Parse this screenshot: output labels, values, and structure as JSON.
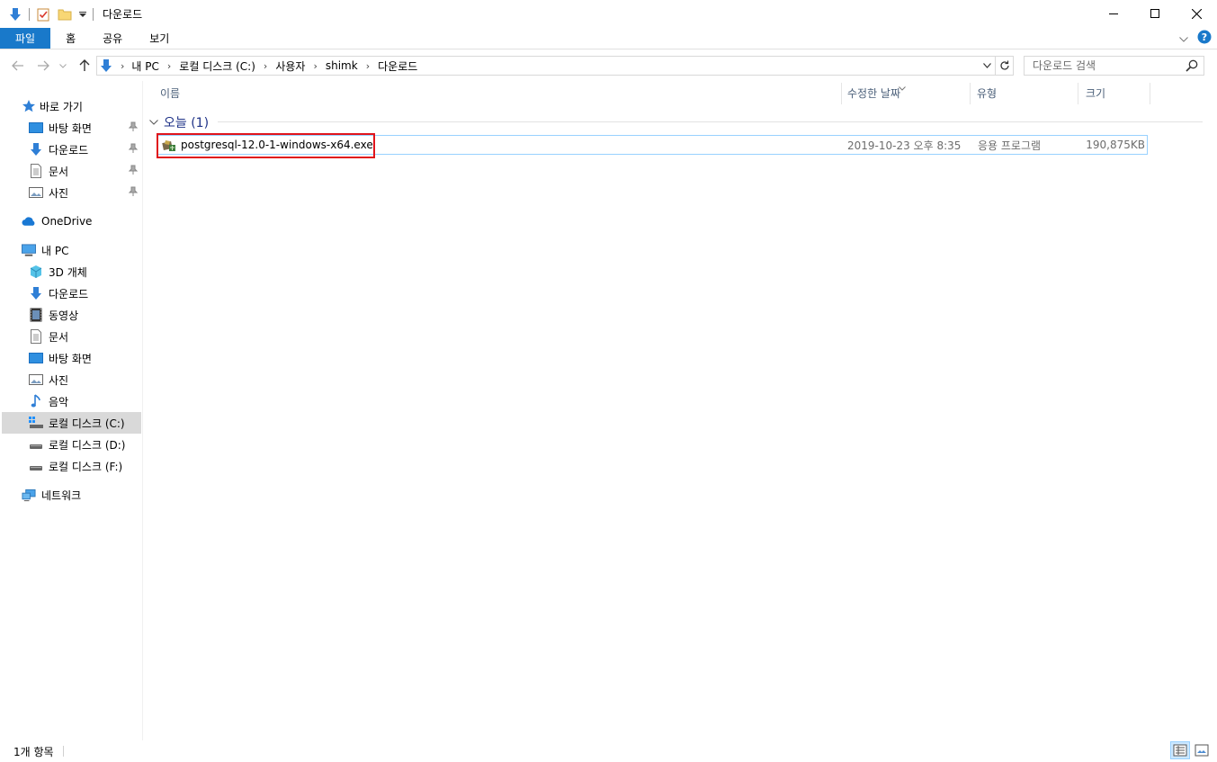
{
  "window": {
    "title": "다운로드"
  },
  "ribbon": {
    "tabs": [
      "파일",
      "홈",
      "공유",
      "보기"
    ]
  },
  "address": {
    "crumbs": [
      "내 PC",
      "로컬 디스크 (C:)",
      "사용자",
      "shimk",
      "다운로드"
    ]
  },
  "search": {
    "placeholder": "다운로드 검색"
  },
  "sidebar": {
    "quick_access": "바로 가기",
    "quick_items": [
      "바탕 화면",
      "다운로드",
      "문서",
      "사진"
    ],
    "onedrive": "OneDrive",
    "this_pc": "내 PC",
    "pc_items": [
      "3D 개체",
      "다운로드",
      "동영상",
      "문서",
      "바탕 화면",
      "사진",
      "음악",
      "로컬 디스크 (C:)",
      "로컬 디스크 (D:)",
      "로컬 디스크 (F:)"
    ],
    "network": "네트워크",
    "selected": "로컬 디스크 (C:)"
  },
  "columns": {
    "name": "이름",
    "modified": "수정한 날짜",
    "type": "유형",
    "size": "크기"
  },
  "group": {
    "label": "오늘 (1)"
  },
  "files": [
    {
      "name": "postgresql-12.0-1-windows-x64.exe",
      "modified": "2019-10-23 오후 8:35",
      "type": "응용 프로그램",
      "size": "190,875KB"
    }
  ],
  "status": {
    "count": "1개 항목"
  },
  "colors": {
    "accent": "#1979ca",
    "selection_border": "#99d1ff",
    "highlight_box": "#e0141b",
    "group_text": "#1e3287"
  }
}
